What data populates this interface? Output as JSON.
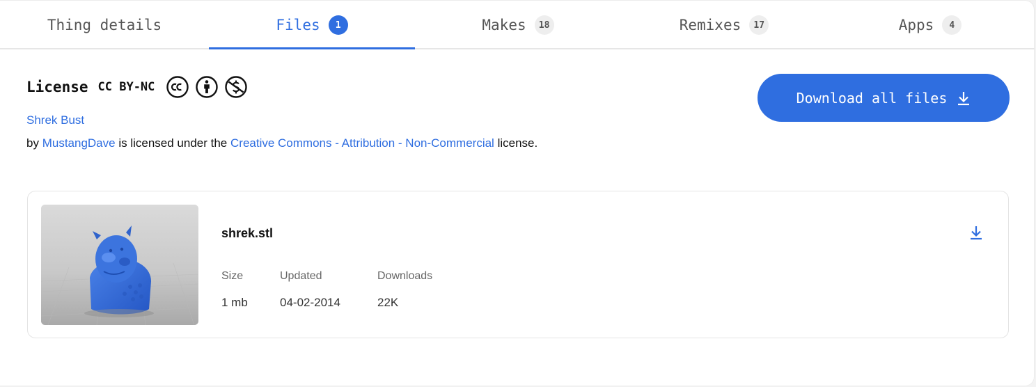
{
  "tabs": [
    {
      "label": "Thing details",
      "count": ""
    },
    {
      "label": "Files",
      "count": "1"
    },
    {
      "label": "Makes",
      "count": "18"
    },
    {
      "label": "Remixes",
      "count": "17"
    },
    {
      "label": "Apps",
      "count": "4"
    }
  ],
  "active_tab": "Files",
  "license": {
    "label": "License",
    "type": "CC BY-NC",
    "icons": [
      "cc-icon",
      "attribution-icon",
      "non-commercial-icon"
    ],
    "thing_name": "Shrek Bust",
    "text_by": "by",
    "author": "MustangDave",
    "text_mid": "is licensed under the",
    "license_link": "Creative Commons - Attribution - Non-Commercial",
    "text_end": "license."
  },
  "download_all": {
    "label": "Download all files",
    "icon": "download-icon"
  },
  "files": [
    {
      "name": "shrek.stl",
      "size_label": "Size",
      "size": "1 mb",
      "updated_label": "Updated",
      "updated": "04-02-2014",
      "downloads_label": "Downloads",
      "downloads": "22K",
      "icon": "download-icon"
    }
  ],
  "colors": {
    "accent": "#2f6ee0",
    "text": "#111111",
    "muted": "#555555",
    "badge_bg": "#eeeeee"
  }
}
